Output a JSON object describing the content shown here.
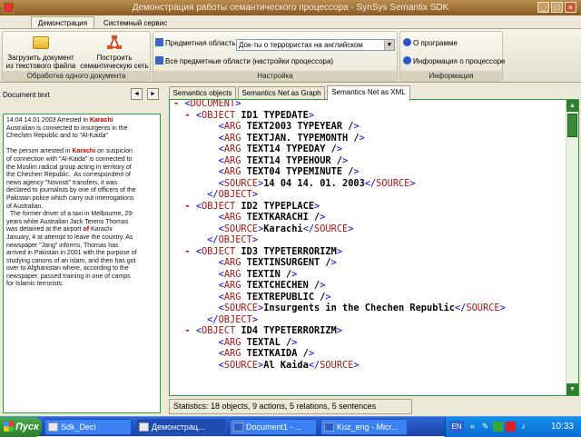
{
  "window": {
    "title": "Демонстрация работы семантического процессора - SynSys Semantix SDK",
    "btn_min": "_",
    "btn_max": "□",
    "btn_close": "×"
  },
  "ribbon": {
    "tabs": [
      "Демонстрация",
      "Системный сервис"
    ],
    "groups": {
      "doc": {
        "label": "Обработка одного документа",
        "load_button": "Загрузить документ из текстового файла",
        "build_button": "Построить семантическую сеть"
      },
      "settings": {
        "label": "Настройка",
        "subject_label": "Предметная область",
        "subject_value": "Док-ты о террористах на английском",
        "all_areas": "Все предметные области (настройки процессора)"
      },
      "info": {
        "label": "Информация",
        "about": "О программе",
        "processor_info": "Информация о процессоре"
      }
    }
  },
  "left": {
    "title": "Document text",
    "prev": "◄",
    "next": "►",
    "paragraphs": [
      [
        {
          "t": "14.04 14.01.2003 Arrested in "
        },
        {
          "t": "Karachi",
          "h": true
        },
        {
          "t": "\nAustralian is connected to insurgents in the\nChechen Republic and to \"Al-Kaida\"\n\n"
        }
      ],
      [
        {
          "t": "The person arrested in "
        },
        {
          "t": "Karachi",
          "h": true
        },
        {
          "t": " on suspicion\nof connection with \"Al-Kaida\" is connected to\nthe Muslim radical group acting in territory of\nthe Chechen Republic.  As correspondent of\nnews agency \"Novosti\" transfers, it was\ndeclared to journalists by one of officers of the\nPakistan police which carry out interrogations\nof Australian.\n  The former driver of a taxi in Melbourne, 29-\nyears white Australian Jack Terens Thomas\nwas detained at the airport "
        },
        {
          "t": "of",
          "h": true
        },
        {
          "t": " Karachi\nJanuary, 4 at attempt to leave the country. As\nnewspaper \"Jang\" informs, Thomas has\narrived in Pakistan in 2001 with the purpose of\nstudying canons of an islam, and then has got\nover to Afghanistan where, according to the\nnewspaper, passed training in one of camps\nfor Islamic terrorists."
        }
      ]
    ]
  },
  "right": {
    "tabs": [
      "Semantics objects",
      "Semantics Net as Graph",
      "Semantics Net as XML"
    ],
    "active_tab": 2,
    "xml_lines": [
      {
        "indent": 0,
        "exp": "-",
        "text": "<DOCUMENT>"
      },
      {
        "indent": 1,
        "exp": "-",
        "text": "<OBJECT ID=\"1\" TYPE=\"DATE\">"
      },
      {
        "indent": 2,
        "exp": "",
        "text": "<ARG TEXT=\"2003\" TYPE=\"YEAR\" />"
      },
      {
        "indent": 2,
        "exp": "",
        "text": "<ARG TEXT=\"JAN.\" TYPE=\"MONTH\" />"
      },
      {
        "indent": 2,
        "exp": "",
        "text": "<ARG TEXT=\"14\" TYPE=\"DAY\" />"
      },
      {
        "indent": 2,
        "exp": "",
        "text": "<ARG TEXT=\"14\" TYPE=\"HOUR\" />"
      },
      {
        "indent": 2,
        "exp": "",
        "text": "<ARG TEXT=\"04\" TYPE=\"MINUTE\" />"
      },
      {
        "indent": 2,
        "exp": "",
        "text": "<SOURCE>14 04 14. 01. 2003</SOURCE>"
      },
      {
        "indent": 1,
        "exp": "",
        "text": "</OBJECT>"
      },
      {
        "indent": 1,
        "exp": "-",
        "text": "<OBJECT ID=\"2\" TYPE=\"PLACE\">"
      },
      {
        "indent": 2,
        "exp": "",
        "text": "<ARG TEXT=\"KARACHI\" />"
      },
      {
        "indent": 2,
        "exp": "",
        "text": "<SOURCE>Karachi</SOURCE>"
      },
      {
        "indent": 1,
        "exp": "",
        "text": "</OBJECT>"
      },
      {
        "indent": 1,
        "exp": "-",
        "text": "<OBJECT ID=\"3\" TYPE=\"TERRORIZM\">"
      },
      {
        "indent": 2,
        "exp": "",
        "text": "<ARG TEXT=\"INSURGENT\" />"
      },
      {
        "indent": 2,
        "exp": "",
        "text": "<ARG TEXT=\"IN\" />"
      },
      {
        "indent": 2,
        "exp": "",
        "text": "<ARG TEXT=\"CHECHEN\" />"
      },
      {
        "indent": 2,
        "exp": "",
        "text": "<ARG TEXT=\"REPUBLIC\" />"
      },
      {
        "indent": 2,
        "exp": "",
        "text": "<SOURCE>Insurgents in the Chechen Republic</SOURCE>"
      },
      {
        "indent": 1,
        "exp": "",
        "text": "</OBJECT>"
      },
      {
        "indent": 1,
        "exp": "-",
        "text": "<OBJECT ID=\"4\" TYPE=\"TERRORIZM\">"
      },
      {
        "indent": 2,
        "exp": "",
        "text": "<ARG TEXT=\"AL\" />"
      },
      {
        "indent": 2,
        "exp": "",
        "text": "<ARG TEXT=\"KAIDA\" />"
      },
      {
        "indent": 2,
        "exp": "",
        "text": "<SOURCE>Al Kaida</SOURCE>"
      }
    ],
    "status": "Statistics: 18 objects, 9 actions, 5 relations, 5 sentences"
  },
  "taskbar": {
    "start": "Пуск",
    "items": [
      "Sdk_Decl",
      "Демонстрац...",
      "Document1 - ...",
      "Kuz_eng - Micr..."
    ],
    "active_item": 1,
    "lang": "EN",
    "clock": "10:33"
  }
}
